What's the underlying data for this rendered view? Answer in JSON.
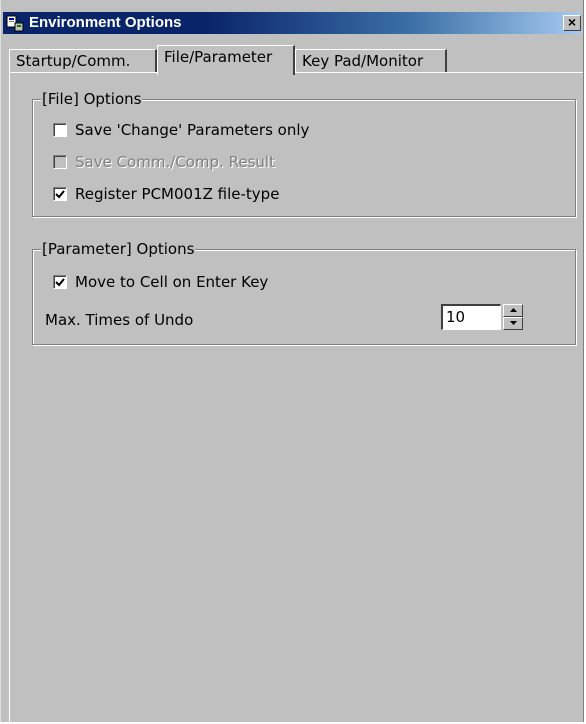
{
  "window": {
    "title": "Environment Options",
    "close_glyph": "×",
    "icon": "app-icon"
  },
  "tabs": [
    {
      "label": "Startup/Comm.",
      "active": false
    },
    {
      "label": "File/Parameter",
      "active": true
    },
    {
      "label": "Key Pad/Monitor",
      "active": false
    }
  ],
  "file_options": {
    "title": "[File] Options",
    "items": [
      {
        "label": "Save 'Change' Parameters only",
        "checked": false,
        "enabled": true
      },
      {
        "label": "Save Comm./Comp. Result",
        "checked": false,
        "enabled": false
      },
      {
        "label": "Register PCM001Z file-type",
        "checked": true,
        "enabled": true
      }
    ]
  },
  "parameter_options": {
    "title": "[Parameter] Options",
    "move_to_cell": {
      "label": "Move to Cell on Enter Key",
      "checked": true,
      "enabled": true
    },
    "undo": {
      "label": "Max. Times of Undo",
      "value": "10"
    }
  },
  "colors": {
    "face": "#c0c0c0",
    "title_active": "#0a246a",
    "title_gradient_end": "#a6caf0",
    "disabled_text": "#808080"
  }
}
